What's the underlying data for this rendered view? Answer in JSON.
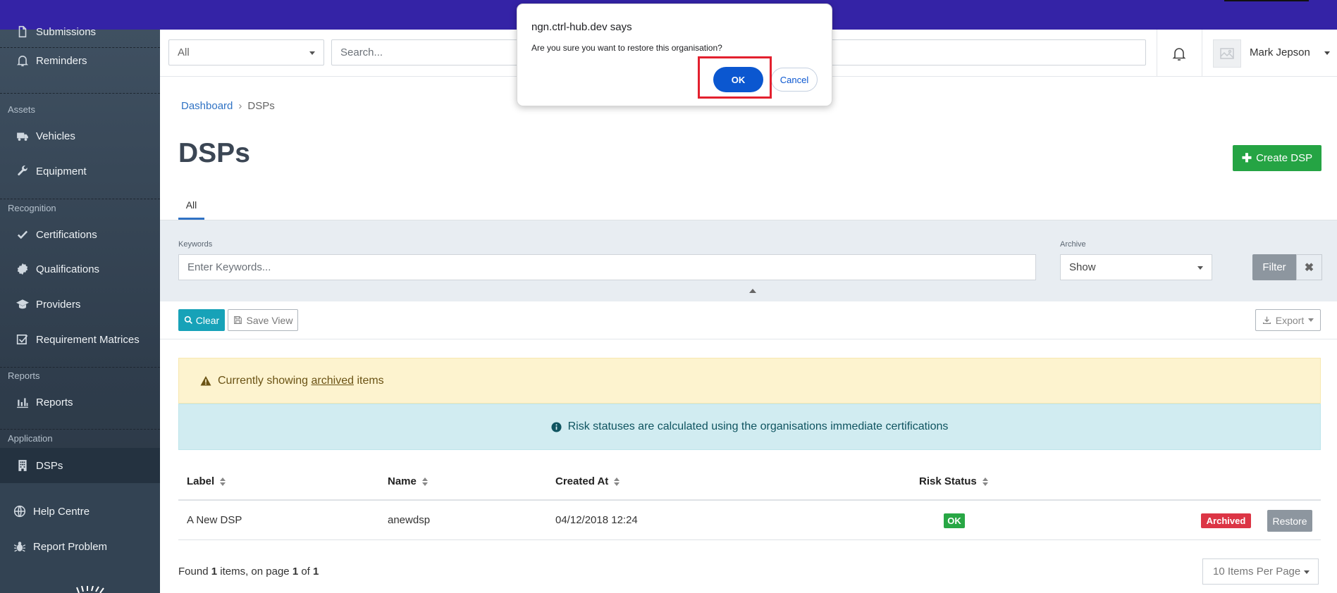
{
  "sidebar": {
    "items": [
      {
        "label": "Submissions",
        "icon": "document-icon"
      },
      {
        "label": "Reminders",
        "icon": "bell-icon"
      },
      {
        "label": "Vehicles",
        "icon": "truck-icon"
      },
      {
        "label": "Equipment",
        "icon": "wrench-icon"
      },
      {
        "label": "Certifications",
        "icon": "check-icon"
      },
      {
        "label": "Qualifications",
        "icon": "badge-icon"
      },
      {
        "label": "Providers",
        "icon": "graduation-cap-icon"
      },
      {
        "label": "Requirement Matrices",
        "icon": "checkbox-icon"
      },
      {
        "label": "Reports",
        "icon": "bar-chart-icon"
      },
      {
        "label": "DSPs",
        "icon": "building-icon"
      },
      {
        "label": "Help Centre",
        "icon": "globe-icon"
      },
      {
        "label": "Report Problem",
        "icon": "bug-icon"
      }
    ],
    "sections": {
      "assets": "Assets",
      "recognition": "Recognition",
      "reports": "Reports",
      "application": "Application"
    }
  },
  "header": {
    "filter_select": "All",
    "search_placeholder": "Search...",
    "user_name": "Mark Jepson"
  },
  "breadcrumb": {
    "home": "Dashboard",
    "separator": "›",
    "current": "DSPs"
  },
  "page": {
    "title": "DSPs",
    "create_label": "Create DSP",
    "tab_all": "All"
  },
  "filters": {
    "keywords_label": "Keywords",
    "keywords_placeholder": "Enter Keywords...",
    "archive_label": "Archive",
    "archive_value": "Show",
    "filter_label": "Filter",
    "clear_label": "Clear",
    "save_view_label": "Save View",
    "export_label": "Export"
  },
  "alerts": {
    "warning_prefix": "Currently showing",
    "warning_link": "archived",
    "warning_suffix": "items",
    "info": "Risk statuses are calculated using the organisations immediate certifications"
  },
  "table": {
    "headers": [
      "Label",
      "Name",
      "Created At",
      "Risk Status"
    ],
    "rows": [
      {
        "label": "A New DSP",
        "name": "anewdsp",
        "created_at": "04/12/2018 12:24",
        "risk_status": "OK",
        "state": "Archived",
        "action": "Restore"
      }
    ]
  },
  "pagination": {
    "found_prefix": "Found",
    "found_count": "1",
    "found_mid": "items, on page",
    "page": "1",
    "of": "of",
    "total_pages": "1",
    "per_page": "10 Items Per Page"
  },
  "dialog": {
    "title": "ngn.ctrl-hub.dev says",
    "message": "Are you sure you want to restore this organisation?",
    "ok": "OK",
    "cancel": "Cancel"
  },
  "colors": {
    "topbar": "#3423a6",
    "sidebar": "#3f5061",
    "primary_link": "#2f72c4",
    "create_button": "#25a444",
    "clear_button": "#17a2b8",
    "ok_badge": "#28a745",
    "archived_badge": "#dc3545",
    "dialog_ok": "#0b57d0",
    "highlight": "#e3202e"
  }
}
